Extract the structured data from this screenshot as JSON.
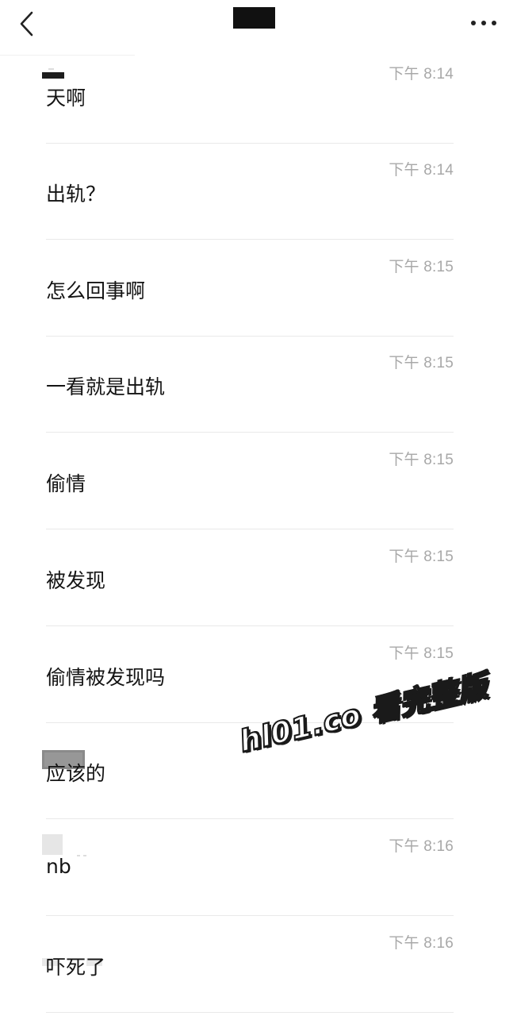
{
  "header": {
    "back_icon": "chevron-left-icon",
    "more_icon": "more-horizontal-icon"
  },
  "messages": [
    {
      "time": "下午 8:14",
      "text": "天啊"
    },
    {
      "time": "下午 8:14",
      "text": "出轨？"
    },
    {
      "time": "下午 8:15",
      "text": "怎么回事啊"
    },
    {
      "time": "下午 8:15",
      "text": "一看就是出轨"
    },
    {
      "time": "下午 8:15",
      "text": "偷情"
    },
    {
      "time": "下午 8:15",
      "text": "被发现"
    },
    {
      "time": "下午 8:15",
      "text": "偷情被发现吗"
    },
    {
      "time": "",
      "text": "应该的"
    },
    {
      "time": "下午 8:16",
      "text": "nb"
    },
    {
      "time": "下午 8:16",
      "text": "吓死了"
    }
  ],
  "watermark": {
    "text": "hl01.co 看完整版"
  },
  "colors": {
    "background": "#ffffff",
    "timestamp": "#a8a8a8",
    "message_text": "#141414",
    "divider": "#e9e9e9",
    "redaction": "#111111"
  }
}
